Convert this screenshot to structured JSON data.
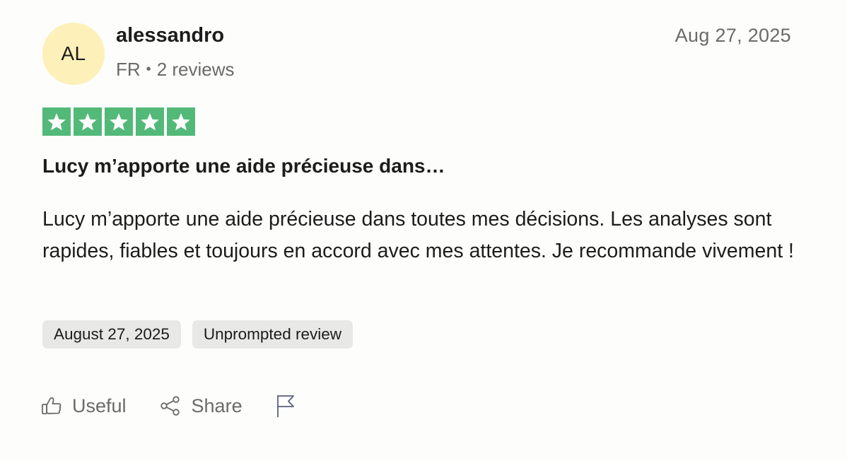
{
  "review": {
    "avatar_initials": "AL",
    "author": "alessandro",
    "country": "FR",
    "separator": "•",
    "reviews_count": "2 reviews",
    "date": "Aug 27, 2025",
    "rating": 5,
    "rating_max": 5,
    "rating_color": "#53b979",
    "avatar_color": "#fdf0b8",
    "title": "Lucy m’apporte une aide précieuse dans…",
    "body": "Lucy m’apporte une aide précieuse dans toutes mes décisions. Les analyses sont rapides, fiables et toujours en accord avec mes attentes. Je recommande vivement !",
    "tags": {
      "date_of_experience": "August 27, 2025",
      "review_type": "Unprompted review"
    }
  },
  "actions": {
    "useful_label": "Useful",
    "useful_icon": "thumbs-up-icon",
    "share_label": "Share",
    "share_icon": "share-icon",
    "report_icon": "flag-icon"
  }
}
